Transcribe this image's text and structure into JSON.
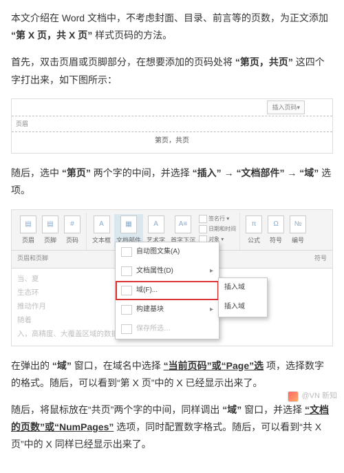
{
  "para1": {
    "t1": "本文介绍在 Word 文档中，不考虑封面、目录、前言等的页数，为正文添加",
    "b1": "“第 X 页，共 X 页”",
    "t2": "样式页码的方法。"
  },
  "para2": {
    "t1": "首先，双击页眉或页脚部分，在想要添加的页码处将",
    "b1": "“第页，共页”",
    "t2": "这四个字打出来，如下图所示："
  },
  "shot1": {
    "insertBtn": "插入页码▾",
    "leftLabel": "页眉",
    "centerText": "第页，共页"
  },
  "para3": {
    "t1": "随后，选中",
    "b1": "“第页”",
    "t2": "两个字的中间，并选择",
    "b2": "“插入”",
    "arrow1": "→",
    "b3": "“文档部件”",
    "arrow2": "→",
    "b4": "“域”",
    "t3": "选项。"
  },
  "ribbon": {
    "btns": [
      "页眉",
      "页脚",
      "页码",
      "文本框",
      "文档部件",
      "艺术字",
      "首字下沉"
    ],
    "sideItems": [
      "签名行 ▾",
      "日期和时间",
      "对象 ▾"
    ],
    "equation": "公式",
    "symbol": "符号",
    "number": "编号",
    "groupLeft": "页眉和页脚",
    "groupRight": "符号"
  },
  "dropdown": {
    "i1": "自动图文集(A)",
    "i2": "文档属性(D)",
    "i3": "域(F)...",
    "i4": "构建基块",
    "i5": "保存所选…",
    "arrow": "▸"
  },
  "submenu": {
    "s1": "插入域",
    "s2": "插入域"
  },
  "ghost": {
    "l1": "当、夏　　　　　　　　　　　　　　相天研充其有亚",
    "l2": "生态环　　　　　　　　　　　　　　故研究由定性到",
    "l3": "推动作月",
    "l4": "随着　　　　　　　　　　　　　大尺度空间范围",
    "l5": "入，高精度、大覆盖区域的数据来源逐渐成为研究中的"
  },
  "para4": {
    "t1": "在弹出的",
    "b1": "“域”",
    "t2": "窗口，在域名中选择",
    "b2": "“当前页码”或“Page”选",
    "t3": "项，选择数字的格式。随后，可以看到“第 X 页”中的 X 已经显示出来了。"
  },
  "para5": {
    "t1": "随后，将鼠标放在“共页”两个字的中间，同样调出",
    "b1": "“域”",
    "t2": "窗口，并选择",
    "b2": "“文档的页数”或“NumPages”",
    "t3": "选项，同时配置数字格式。随后，可以看到“共 X 页”中的 X 同样已经显示出来了。"
  },
  "watermark": "@VN 新知"
}
